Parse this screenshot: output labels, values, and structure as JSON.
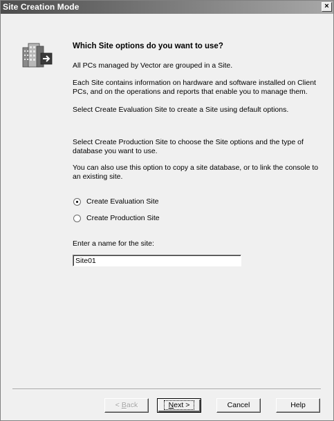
{
  "window": {
    "title": "Site Creation Mode",
    "close_glyph": "×"
  },
  "content": {
    "heading": "Which Site options do you want to use?",
    "para1": "All PCs managed by Vector are grouped in a Site.",
    "para2": "Each Site contains information on hardware and software installed on Client PCs, and on the operations and reports that enable you to manage them.",
    "para3": "Select Create Evaluation Site to create a Site using default options.",
    "para4": "Select Create Production Site to choose the Site options and the type of database you want to use.",
    "para5": "You can also use this option to copy a site database, or  to link the console to an existing site."
  },
  "options": {
    "evaluation_label": "Create Evaluation Site",
    "production_label": "Create Production Site",
    "selected": "evaluation"
  },
  "name_field": {
    "label": "Enter a name for the site:",
    "value": "Site01"
  },
  "buttons": {
    "back_mnemonic": "B",
    "back_rest": "ack",
    "back_prefix": "< ",
    "next_mnemonic": "N",
    "next_rest": "ext >",
    "cancel": "Cancel",
    "help": "Help"
  },
  "icons": {
    "wizard": "building-arrow-icon"
  }
}
